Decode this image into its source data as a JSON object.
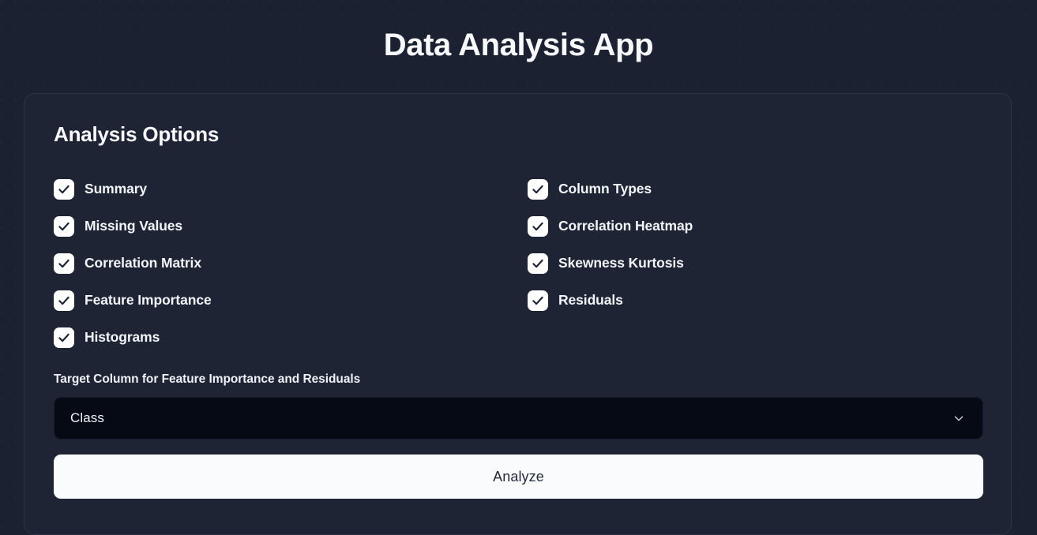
{
  "app": {
    "title": "Data Analysis App",
    "background_color": "#1b2130",
    "card_color": "#1e2433",
    "accent_color": "#fafbfd"
  },
  "card": {
    "heading": "Analysis Options"
  },
  "options": {
    "left_column": [
      {
        "label": "Summary",
        "checked": true
      },
      {
        "label": "Missing Values",
        "checked": true
      },
      {
        "label": "Correlation Matrix",
        "checked": true
      },
      {
        "label": "Feature Importance",
        "checked": true
      },
      {
        "label": "Histograms",
        "checked": true
      }
    ],
    "right_column": [
      {
        "label": "Column Types",
        "checked": true
      },
      {
        "label": "Correlation Heatmap",
        "checked": true
      },
      {
        "label": "Skewness Kurtosis",
        "checked": true
      },
      {
        "label": "Residuals",
        "checked": true
      }
    ]
  },
  "target_column": {
    "label": "Target Column for Feature Importance and Residuals",
    "selected": "Class",
    "icon": "chevron-down-icon"
  },
  "actions": {
    "analyze_label": "Analyze"
  }
}
